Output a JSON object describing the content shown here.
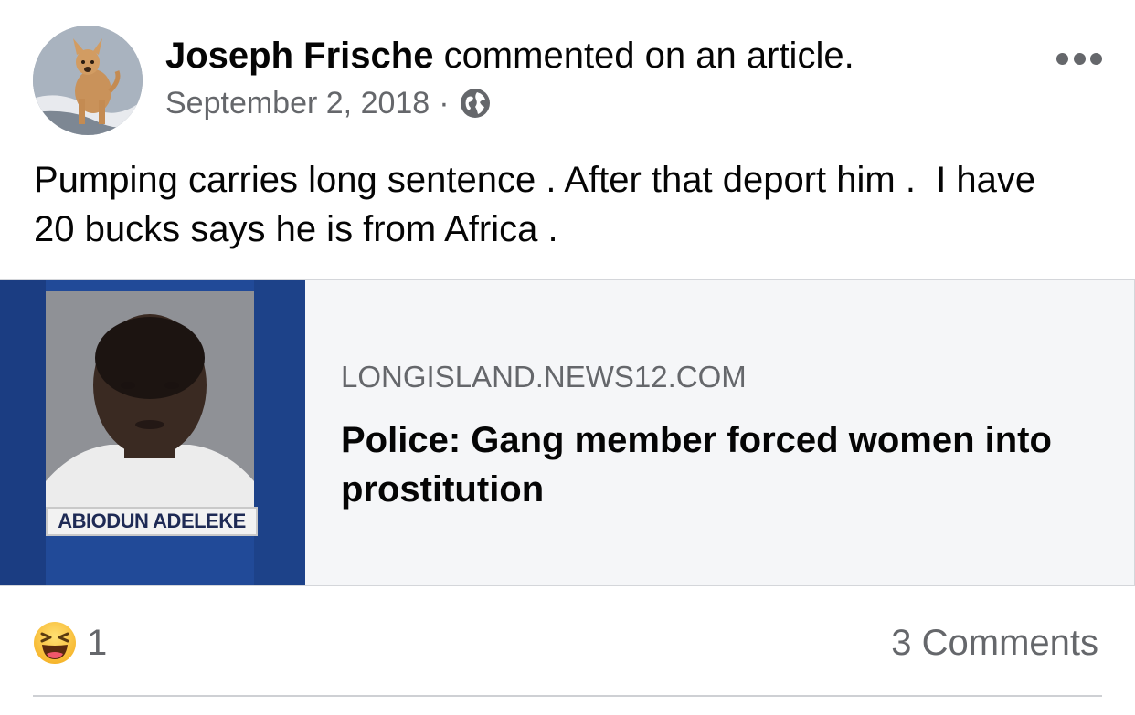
{
  "header": {
    "author_name": "Joseph Frische",
    "action_text": "commented on an article.",
    "date": "September 2, 2018",
    "separator": "·",
    "privacy_icon": "globe-icon",
    "more_icon": "more-options-icon"
  },
  "post": {
    "text": "Pumping carries long sentence . After that deport him .  I have 20 bucks says he is from Africa ."
  },
  "link_card": {
    "thumbnail_caption": "ABIODUN ADELEKE",
    "domain": "LONGISLAND.NEWS12.COM",
    "title": "Police: Gang member forced women into prostitution"
  },
  "footer": {
    "reaction_icon": "haha-reaction-icon",
    "reaction_count": "1",
    "comments_label": "3 Comments"
  },
  "colors": {
    "text_primary": "#050505",
    "text_secondary": "#65676b",
    "card_background": "#f5f6f8",
    "thumbnail_blue": "#234c9c"
  }
}
